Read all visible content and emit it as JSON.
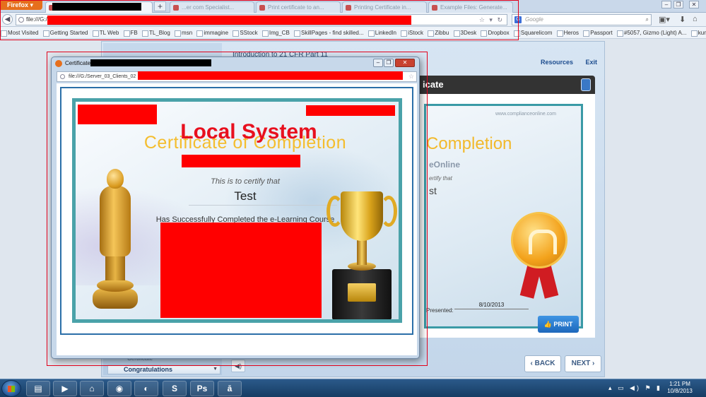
{
  "browser": {
    "menu_button": "Firefox",
    "tabs": [
      {
        "label": "",
        "active": true
      },
      {
        "label": "...er com Specialist..."
      },
      {
        "label": "Print certificate to an..."
      },
      {
        "label": "Printing Certificate in..."
      },
      {
        "label": "Example Files: Generate..."
      }
    ],
    "new_tab": "+",
    "url": "file:///G:/",
    "search_placeholder": "Google",
    "bookmarks": [
      "Most Visited",
      "Getting Started",
      "TL Web",
      "FB",
      "TL_Blog",
      "msn",
      "immagine",
      "SStock",
      "Img_CB",
      "SkillPages - find skilled...",
      "LinkedIn",
      "iStock",
      "Zibbu",
      "3Desk",
      "Dropbox",
      "Squarelicom",
      "Heros",
      "Passport",
      "#5057, Gizmo (Light) A...",
      "kumbal"
    ]
  },
  "lms": {
    "course_title": "Introduction to 21 CFR Part 11",
    "resources_link": "Resources",
    "exit_link": "Exit",
    "panel_title": "icate",
    "bg_cert": {
      "site": "www.complianceonline.com",
      "completion": "Completion",
      "online": "eOnline",
      "certify": "ertify that",
      "student": "st",
      "presented_label": "Presented:",
      "date": "8/10/2013"
    },
    "print_button": "PRINT",
    "back_button": "BACK",
    "next_button": "NEXT",
    "sidebar_item_certificate": "Certificate",
    "sidebar_item_current": "Congratulations"
  },
  "popup": {
    "title": "Certificate",
    "url": "file:///G:/Server_03_Clients_02",
    "certificate": {
      "heading": "Certificate of Completion",
      "overlay_text": "Local System",
      "certify_text": "This is to certify that",
      "student_name": "Test",
      "completed_text": "Has Successfully Completed the e-Learning Course"
    }
  },
  "taskbar": {
    "apps": [
      "folder",
      "media",
      "explorer",
      "chrome",
      "firefox",
      "skype",
      "Ps",
      "ā"
    ],
    "time": "1:21 PM",
    "date": "10/8/2013"
  },
  "colors": {
    "redaction": "#ff0000",
    "annotation_box": "#e0001a",
    "accent_blue": "#1d67bc",
    "cert_gold": "#f4bd2e",
    "cert_border": "#4aa2a9"
  }
}
